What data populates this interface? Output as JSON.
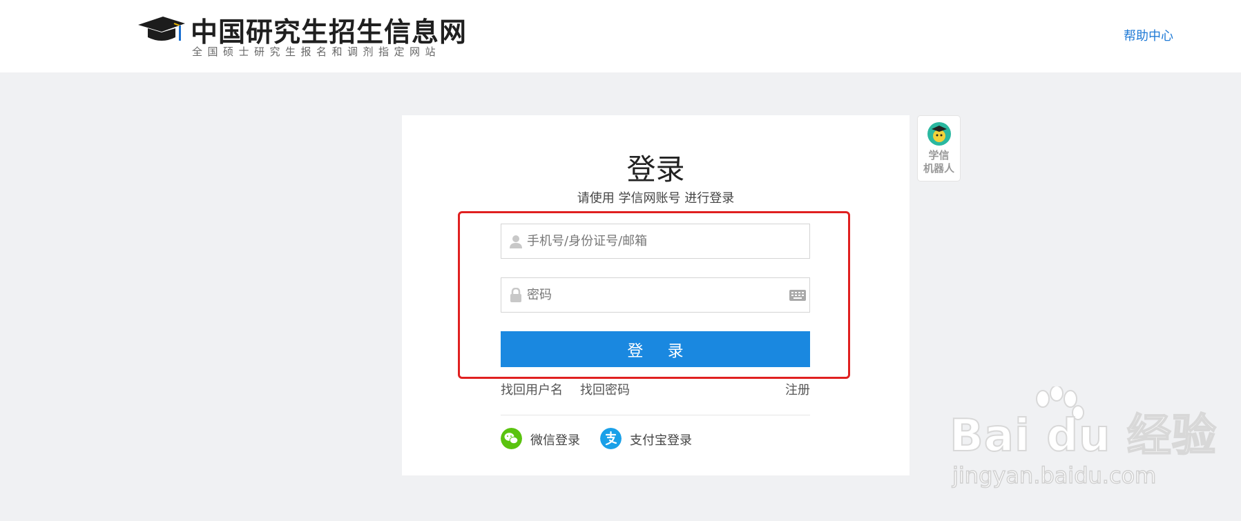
{
  "header": {
    "site_title": "中国研究生招生信息网",
    "site_subtitle": "全国硕士研究生报名和调剂指定网站",
    "help_link": "帮助中心"
  },
  "login": {
    "title": "登录",
    "subtitle": "请使用 学信网账号 进行登录",
    "username_placeholder": "手机号/身份证号/邮箱",
    "password_placeholder": "密码",
    "submit_label": "登 录",
    "links": {
      "find_username": "找回用户名",
      "find_password": "找回密码",
      "register": "注册"
    },
    "social": {
      "wechat_label": "微信登录",
      "alipay_label": "支付宝登录"
    }
  },
  "robot": {
    "label_line1": "学信",
    "label_line2": "机器人"
  },
  "watermark": {
    "brand": "Bai du 经验",
    "url": "jingyan.baidu.com"
  },
  "colors": {
    "primary": "#1a88e0",
    "link": "#1f7ad6",
    "highlight": "#e02020",
    "wechat": "#5ac30f",
    "alipay": "#1aa0e8",
    "background": "#f0f1f3"
  },
  "icons": [
    "graduation-cap-icon",
    "user-icon",
    "lock-icon",
    "keyboard-icon",
    "wechat-icon",
    "alipay-icon",
    "robot-avatar-icon"
  ]
}
